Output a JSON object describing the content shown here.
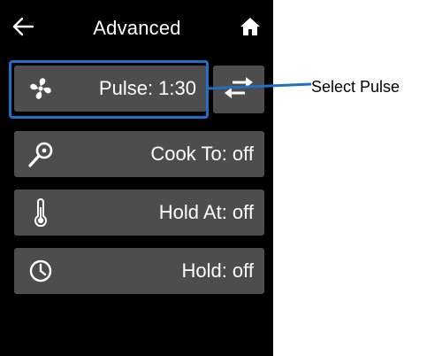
{
  "header": {
    "title": "Advanced",
    "back_icon": "arrow-left-icon",
    "home_icon": "home-icon"
  },
  "rows": [
    {
      "id": "pulse",
      "label": "Pulse: 1:30",
      "icon": "fan-icon"
    },
    {
      "id": "cook-to",
      "label": "Cook To: off",
      "icon": "probe-icon"
    },
    {
      "id": "hold-at",
      "label": "Hold At: off",
      "icon": "thermometer-icon"
    },
    {
      "id": "hold",
      "label": "Hold: off",
      "icon": "clock-icon"
    }
  ],
  "swap_button": {
    "icon": "swap-arrows-icon"
  },
  "callout": {
    "text": "Select Pulse",
    "color": "#1f6fc4"
  },
  "colors": {
    "background": "#000000",
    "row": "#4d4d4d",
    "text": "#ffffff",
    "highlight": "#1f6fc4"
  }
}
